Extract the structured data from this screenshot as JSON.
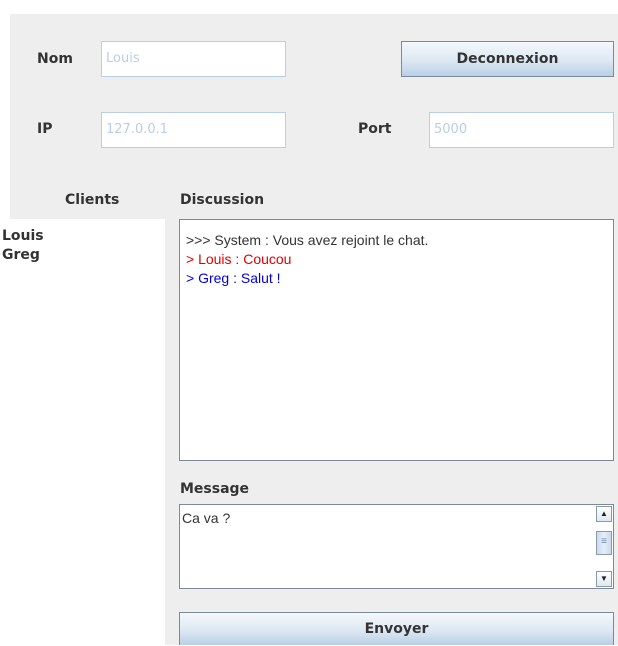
{
  "connection": {
    "nom_label": "Nom",
    "nom_value": "Louis",
    "deconnexion_label": "Deconnexion",
    "ip_label": "IP",
    "ip_value": "127.0.0.1",
    "port_label": "Port",
    "port_value": "5000"
  },
  "clients": {
    "title": "Clients",
    "items": [
      "Louis",
      "Greg"
    ]
  },
  "discussion": {
    "title": "Discussion",
    "lines": [
      {
        "text": ">>> System : Vous avez rejoint le chat.",
        "color": "#333333"
      },
      {
        "text": "> Louis : Coucou",
        "color": "#e00000"
      },
      {
        "text": "> Greg : Salut !",
        "color": "#0000e0"
      }
    ]
  },
  "message": {
    "title": "Message",
    "value": "Ca va ?",
    "scroll_up_icon": "arrow-up-icon",
    "scroll_down_icon": "arrow-down-icon"
  },
  "send": {
    "label": "Envoyer"
  },
  "colors": {
    "panel_bg": "#eeeeee",
    "field_border": "#b8cfe5",
    "button_gradient_end": "#b8cfe5"
  }
}
